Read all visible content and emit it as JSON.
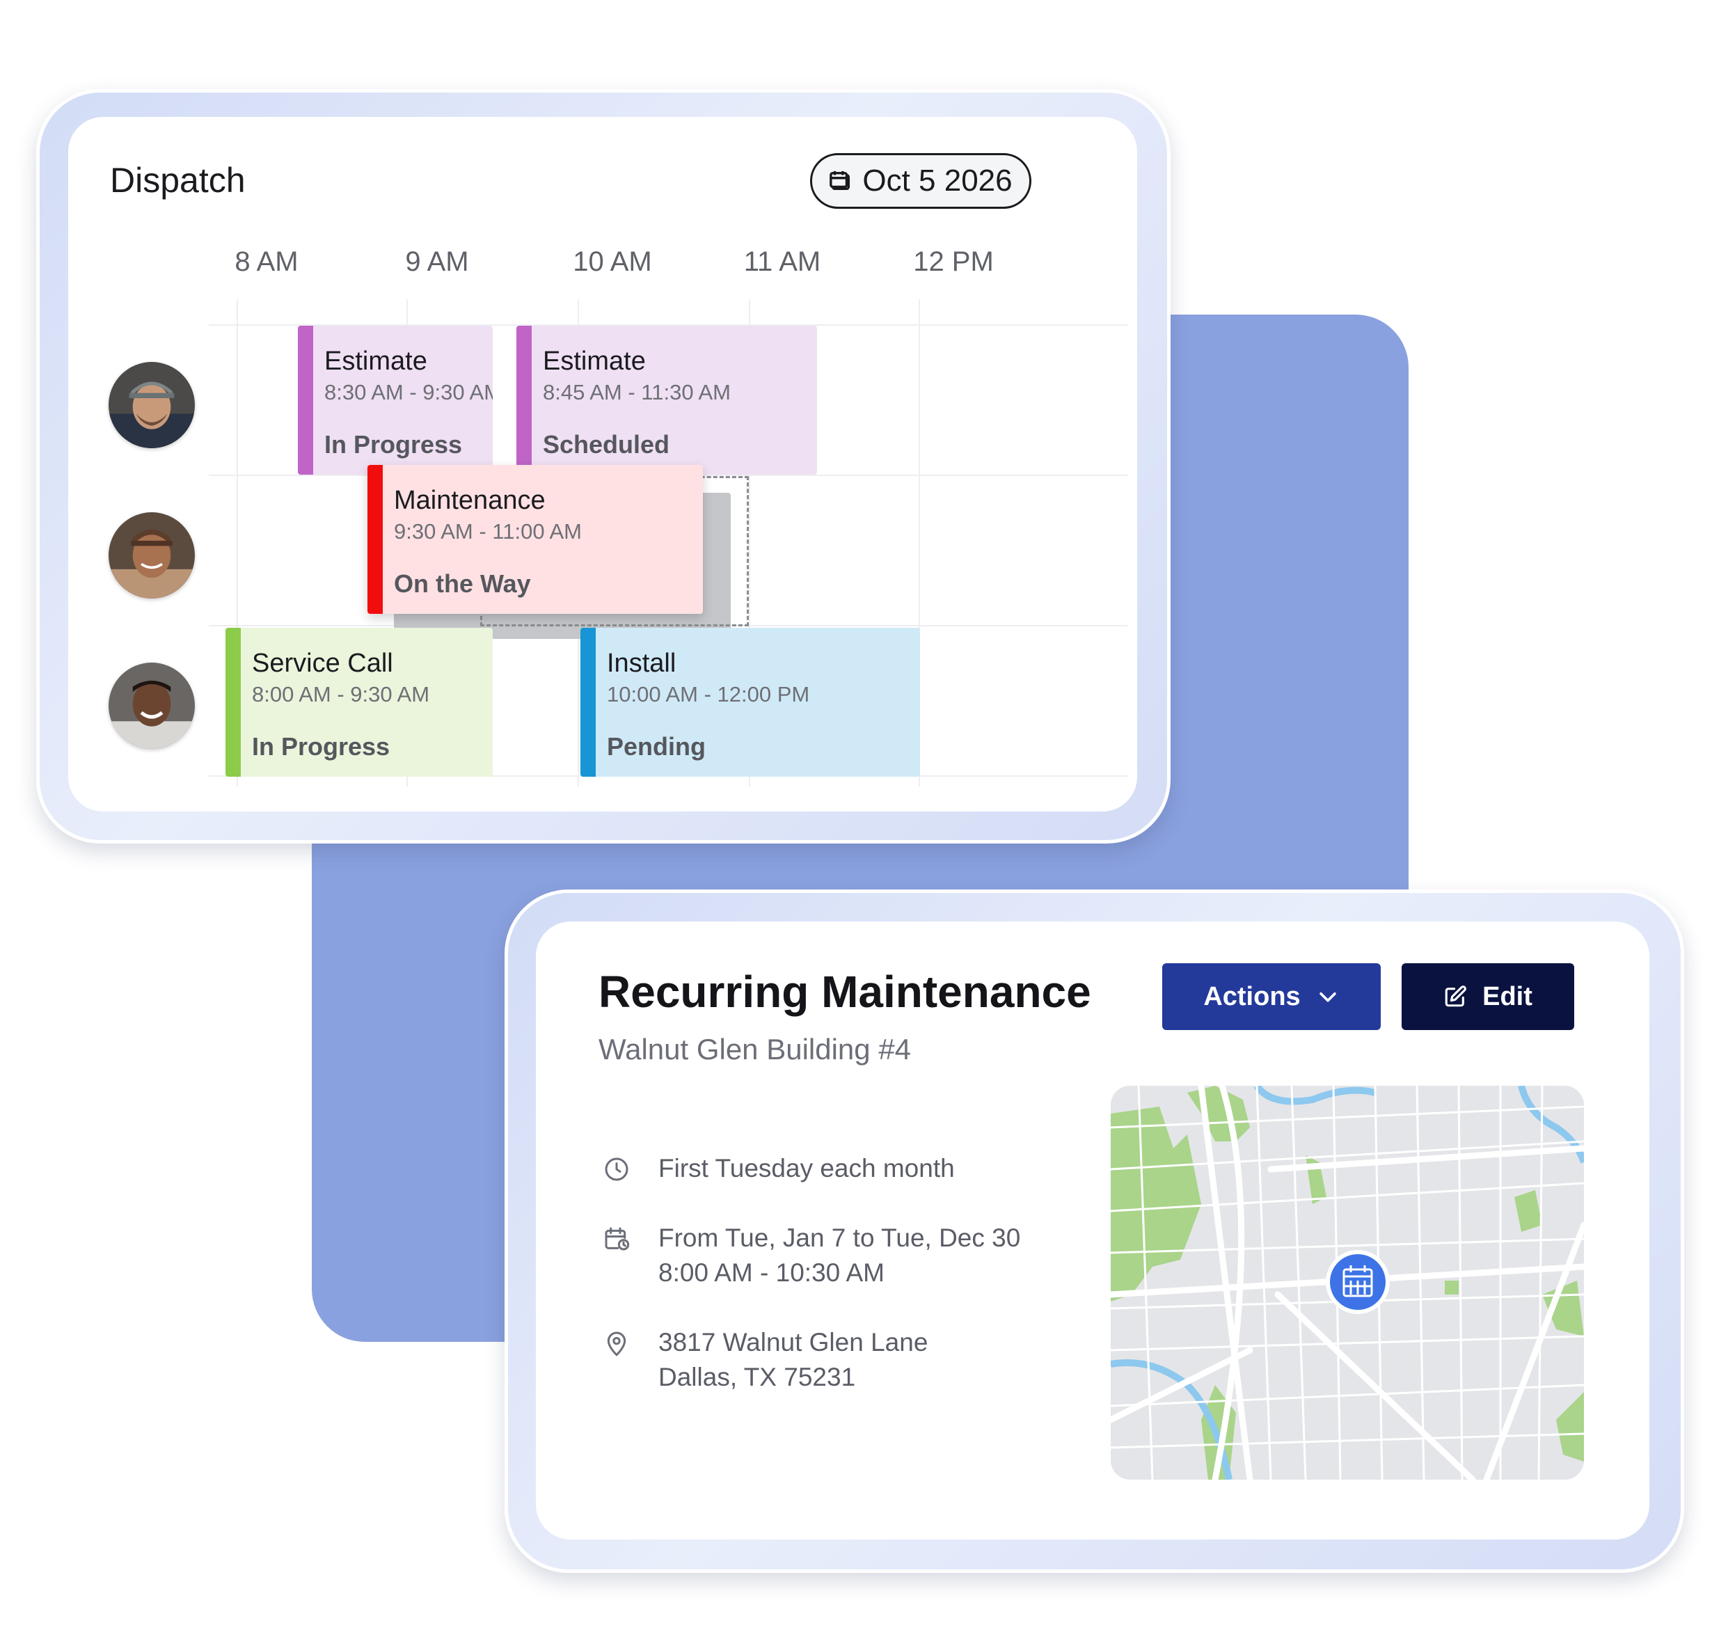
{
  "dispatch": {
    "title": "Dispatch",
    "date": "Oct 5 2026",
    "date_icon": "calendar-icon",
    "time_labels": [
      "8 AM",
      "9 AM",
      "10 AM",
      "11 AM",
      "12 PM"
    ],
    "technicians": [
      "technician-1",
      "technician-2",
      "technician-3"
    ],
    "events": [
      {
        "title": "Estimate",
        "time": "8:30 AM - 9:30 AM",
        "status": "In Progress",
        "color": "#c064c8",
        "bg": "#efe0f3"
      },
      {
        "title": "Estimate",
        "time": "8:45 AM - 11:30 AM",
        "status": "Scheduled",
        "color": "#c064c8",
        "bg": "#efe0f3"
      },
      {
        "title": "Maintenance",
        "time": "9:30 AM - 11:00 AM",
        "status": "On the Way",
        "color": "#f20d0d",
        "bg": "#ffe1e4"
      },
      {
        "title": "Service Call",
        "time": "8:00 AM - 9:30 AM",
        "status": "In Progress",
        "color": "#8ccc4a",
        "bg": "#eaf5dc"
      },
      {
        "title": "Install",
        "time": "10:00 AM - 12:00 PM",
        "status": "Pending",
        "color": "#1795d4",
        "bg": "#d0e9f7"
      }
    ]
  },
  "recurring": {
    "title": "Recurring Maintenance",
    "subtitle": "Walnut Glen Building #4",
    "actions_label": "Actions",
    "edit_label": "Edit",
    "schedule": "First Tuesday each month",
    "date_range": "From Tue, Jan 7  to Tue, Dec 30",
    "time_range": "8:00 AM - 10:30 AM",
    "address_line1": "3817 Walnut Glen Lane",
    "address_line2": "Dallas, TX 75231",
    "icons": [
      "clock-icon",
      "calendar-clock-icon",
      "location-pin-icon",
      "chevron-down-icon",
      "edit-icon",
      "calendar-pin-icon"
    ]
  },
  "colors": {
    "accent_blue": "#8aa1df",
    "actions_button": "#233a9a",
    "edit_button": "#0a1340",
    "map_pin": "#3d73e6"
  }
}
